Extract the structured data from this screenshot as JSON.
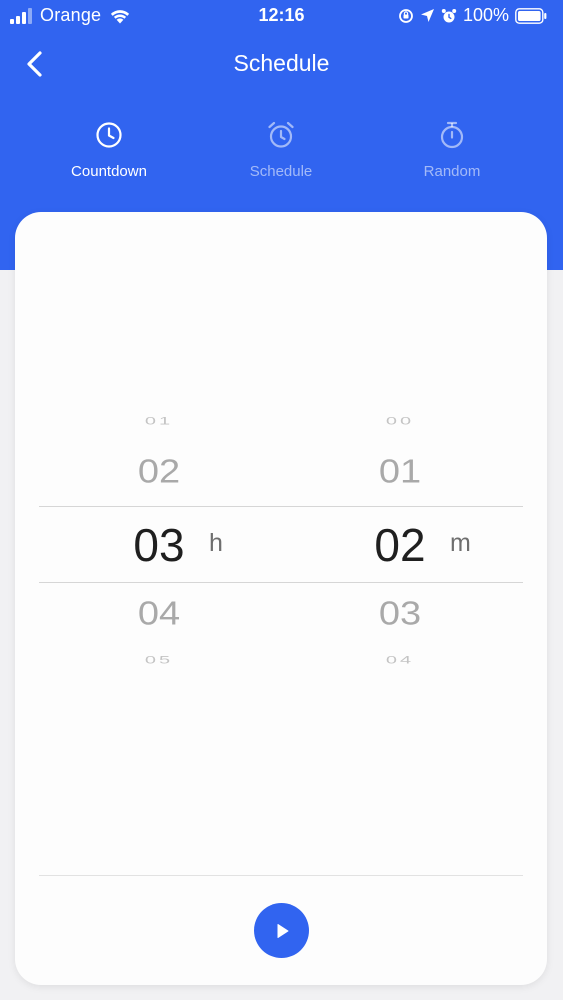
{
  "status_bar": {
    "carrier": "Orange",
    "time": "12:16",
    "battery_percent": "100%"
  },
  "nav": {
    "title": "Schedule"
  },
  "tabs": [
    {
      "label": "Countdown",
      "icon": "clock-icon",
      "active": true
    },
    {
      "label": "Schedule",
      "icon": "alarm-clock-icon",
      "active": false
    },
    {
      "label": "Random",
      "icon": "stopwatch-icon",
      "active": false
    }
  ],
  "picker": {
    "hours": {
      "values": [
        "01",
        "02",
        "03",
        "04",
        "05"
      ],
      "selected": "03",
      "unit": "h"
    },
    "minutes": {
      "values": [
        "00",
        "01",
        "02",
        "03",
        "04"
      ],
      "selected": "02",
      "unit": "m"
    }
  },
  "colors": {
    "accent": "#3164f0",
    "background": "#f1f1f3",
    "card": "#fdfdfd"
  }
}
